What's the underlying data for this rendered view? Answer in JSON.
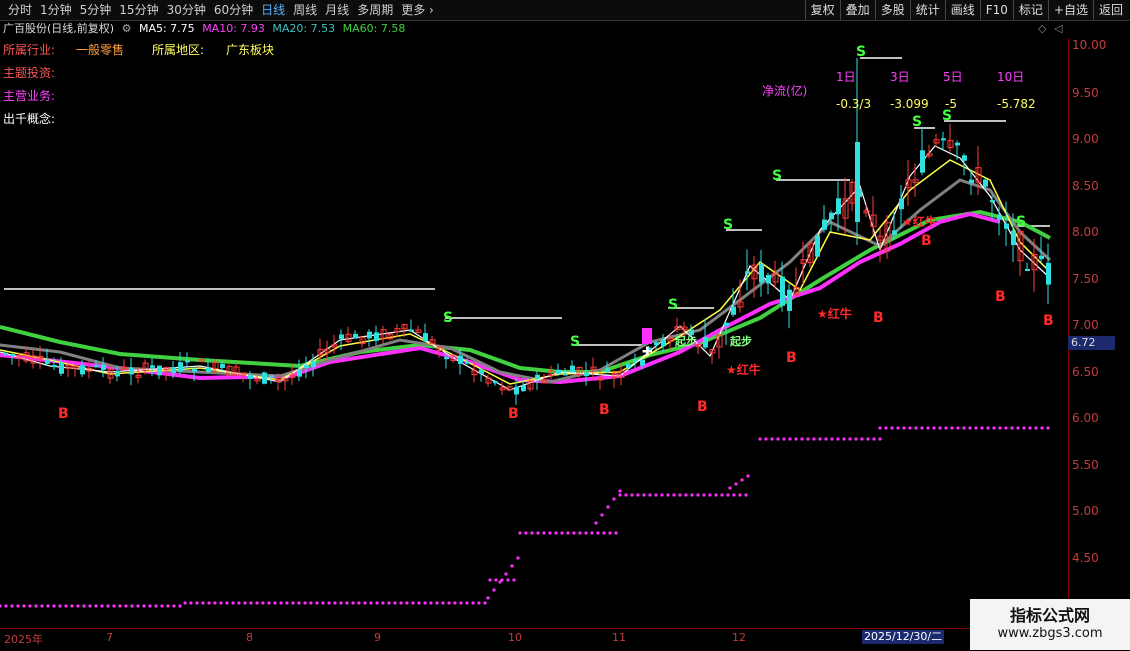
{
  "toolbar": {
    "periods": [
      "分时",
      "1分钟",
      "5分钟",
      "15分钟",
      "30分钟",
      "60分钟",
      "日线",
      "周线",
      "月线",
      "多周期",
      "更多 ›"
    ],
    "active_period": "日线",
    "right_buttons": [
      "复权",
      "叠加",
      "多股",
      "统计",
      "画线",
      "F10",
      "标记",
      "+自选",
      "返回"
    ]
  },
  "stock": {
    "title": "广百股份(日线,前复权)",
    "ma5": "MA5: 7.75",
    "ma10": "MA10: 7.93",
    "ma20": "MA20: 7.53",
    "ma60": "MA60: 7.58"
  },
  "info": {
    "industry_label": "所属行业:",
    "industry_value": "一般零售",
    "region_label": "所属地区:",
    "region_value": "广东板块",
    "theme_label": "主题投资:",
    "business_label": "主营业务:",
    "concept_label": "出千概念:"
  },
  "netflow": {
    "label": "净流(亿)",
    "periods": [
      "1日",
      "3日",
      "5日",
      "10日"
    ],
    "values": [
      "-0.3/3",
      "-3.099",
      "-5",
      "-5.782"
    ]
  },
  "signals": {
    "b": "B",
    "s": "S",
    "hongniu": "★红牛",
    "qibu": "起步",
    "cross": "✚"
  },
  "price_axis": [
    "10.00",
    "9.50",
    "9.00",
    "8.50",
    "8.00",
    "7.50",
    "7.00",
    "6.50",
    "6.00",
    "5.50",
    "5.00",
    "4.50"
  ],
  "current_price": "6.72",
  "date_axis": [
    "2025年",
    "7",
    "8",
    "9",
    "10",
    "11",
    "12"
  ],
  "crosshair_date": "2025/12/30/二",
  "watermark": {
    "line1": "指标公式网",
    "line2": "www.zbgs3.com"
  },
  "colors": {
    "up": "#ff3a3a",
    "down": "#2fe0e0",
    "ma5": "#ffffff",
    "ma10": "#ffff40",
    "ma20": "#808080",
    "ma60": "#40d040",
    "trend": "#ff30ff"
  }
}
